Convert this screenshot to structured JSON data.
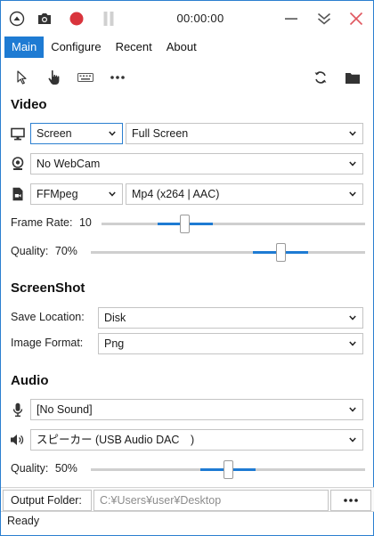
{
  "app": {
    "timer": "00:00:00",
    "accent_color": "#1e7bd3",
    "record_color": "#d9343c"
  },
  "icons": {
    "collapse": "circle-up-arrow-icon",
    "screenshot": "camera-icon",
    "record": "record-icon",
    "pause": "pause-icon",
    "minimize": "minimize-icon",
    "minimize_to_tray": "double-chevron-down-icon",
    "close": "close-icon",
    "cursor": "cursor-icon",
    "clicks": "hand-pointer-icon",
    "keystrokes": "keyboard-icon",
    "more_tools": "more-icon",
    "refresh": "refresh-icon",
    "folder": "folder-icon"
  },
  "tabs": [
    {
      "label": "Main",
      "active": true
    },
    {
      "label": "Configure",
      "active": false
    },
    {
      "label": "Recent",
      "active": false
    },
    {
      "label": "About",
      "active": false
    }
  ],
  "video": {
    "heading": "Video",
    "source": "Screen",
    "source_option": "Full Screen",
    "webcam": "No WebCam",
    "encoder": "FFMpeg",
    "format": "Mp4 (x264 | AAC)",
    "frame_rate_label": "Frame Rate:",
    "frame_rate_value": "10",
    "frame_rate_level": 0.31,
    "quality_label": "Quality:",
    "quality_value": "70%",
    "quality_level": 0.7
  },
  "screenshot": {
    "heading": "ScreenShot",
    "save_location_label": "Save Location:",
    "save_location": "Disk",
    "image_format_label": "Image Format:",
    "image_format": "Png"
  },
  "audio": {
    "heading": "Audio",
    "microphone": "[No Sound]",
    "speaker": "スピーカー (USB Audio DAC　)",
    "quality_label": "Quality:",
    "quality_value": "50%",
    "quality_level": 0.5
  },
  "output": {
    "label": "Output Folder:",
    "placeholder": "C:¥Users¥user¥Desktop",
    "more_label": "•••"
  },
  "status": "Ready"
}
